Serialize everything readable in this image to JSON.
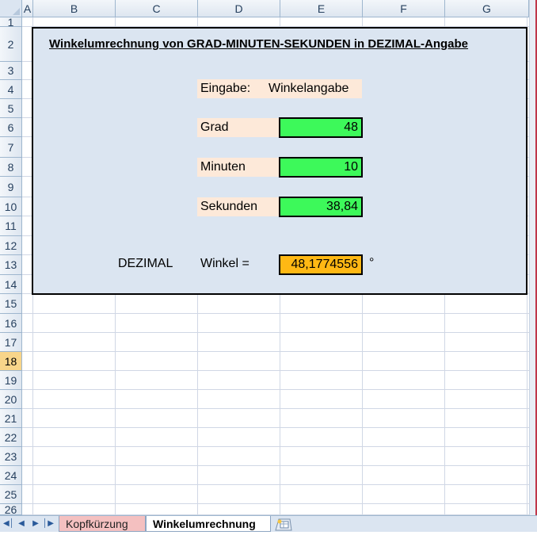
{
  "sheet": {
    "columns": [
      "A",
      "B",
      "C",
      "D",
      "E",
      "F",
      "G"
    ],
    "rows": [
      "1",
      "2",
      "3",
      "4",
      "5",
      "6",
      "7",
      "8",
      "9",
      "10",
      "11",
      "12",
      "13",
      "14",
      "15",
      "16",
      "17",
      "18",
      "19",
      "20",
      "21",
      "22",
      "23",
      "24",
      "25",
      "26"
    ],
    "selected_row": "18"
  },
  "content": {
    "title": "Winkelumrechnung von GRAD-MINUTEN-SEKUNDEN  in DEZIMAL-Angabe",
    "eingabe_label": "Eingabe:",
    "eingabe_value": "Winkelangabe",
    "grad_label": "Grad",
    "grad_value": "48",
    "minuten_label": "Minuten",
    "minuten_value": "10",
    "sekunden_label": "Sekunden",
    "sekunden_value": "38,84",
    "dezimal_label": "DEZIMAL",
    "winkel_label": "Winkel =",
    "result_value": "48,1774556",
    "degree_symbol": "°"
  },
  "tabs": {
    "sheet1": "Kopfkürzung",
    "sheet2": "Winkelumrechnung"
  },
  "colors": {
    "panel_bg": "#dbe5f1",
    "label_bg": "#fde9d9",
    "input_bg": "#3df95a",
    "result_bg": "#ffb814"
  }
}
